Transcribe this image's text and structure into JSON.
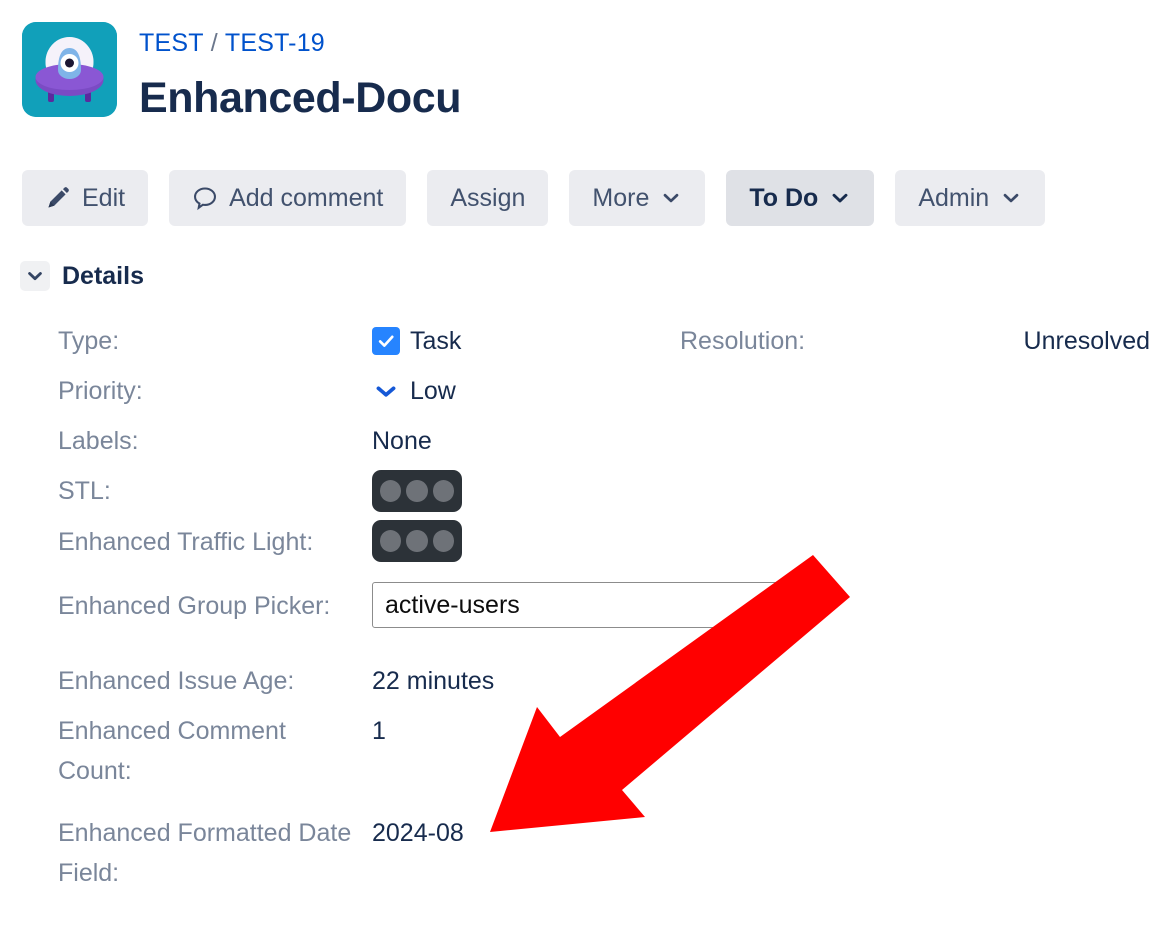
{
  "header": {
    "breadcrumb": {
      "project": "TEST",
      "separator": "/",
      "issue_key": "TEST-19"
    },
    "issue_title": "Enhanced-Docu",
    "avatar_icon": "ufo-avatar-icon"
  },
  "toolbar": {
    "edit_label": "Edit",
    "add_comment_label": "Add comment",
    "assign_label": "Assign",
    "more_label": "More",
    "status_label": "To Do",
    "admin_label": "Admin",
    "edit_icon": "pencil-icon",
    "comment_icon": "comment-bubble-icon",
    "chevron_icon": "chevron-down-icon"
  },
  "details": {
    "section_title": "Details",
    "collapse_icon": "chevron-down-icon",
    "fields": [
      {
        "label": "Type:",
        "value": "Task",
        "icon": "task-checkbox-icon"
      },
      {
        "label": "Priority:",
        "value": "Low",
        "icon": "priority-low-chevron-icon"
      },
      {
        "label": "Labels:",
        "value": "None"
      },
      {
        "label": "STL:",
        "value": "",
        "icon": "traffic-light-icon"
      },
      {
        "label": "Enhanced Traffic Light:",
        "value": "",
        "icon": "traffic-light-icon"
      },
      {
        "label": "Enhanced Group Picker:",
        "value": "active-users"
      },
      {
        "label": "Enhanced Issue Age:",
        "value": "22 minutes"
      },
      {
        "label": "Enhanced Comment Count:",
        "value": "1"
      },
      {
        "label": "Enhanced Formatted Date Field:",
        "value": "2024-08"
      }
    ],
    "resolution": {
      "label": "Resolution:",
      "value": "Unresolved"
    },
    "group_picker": {
      "value": "active-users"
    }
  },
  "annotation": {
    "arrow_color": "#FF0000",
    "arrow_icon": "red-arrow-pointer"
  },
  "colors": {
    "link": "#0052CC",
    "text": "#172B4D",
    "muted": "#7A869A",
    "button_bg": "#EBECF0",
    "status_bg": "#DFE1E6",
    "accent_blue": "#2684FF",
    "traffic_body": "#2C3238",
    "traffic_lamp": "#6E7278",
    "avatar_bg": "#11A0BA"
  }
}
